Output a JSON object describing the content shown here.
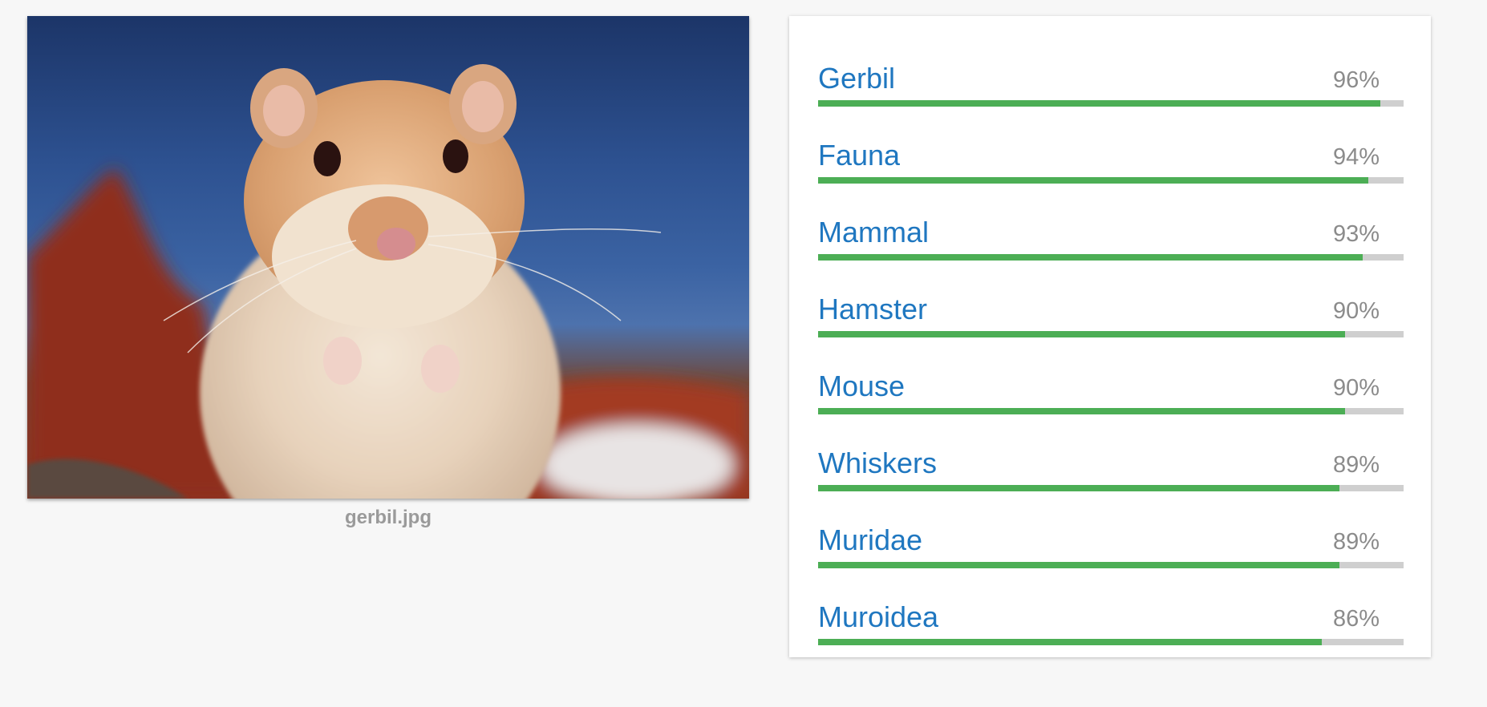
{
  "image": {
    "filename": "gerbil.jpg"
  },
  "colors": {
    "label": "#1f77c0",
    "bar_fill": "#4cae55",
    "bar_track": "#cfcfcf",
    "percent": "#8b8b8b"
  },
  "labels": [
    {
      "name": "Gerbil",
      "percent": "96%",
      "score": 0.96
    },
    {
      "name": "Fauna",
      "percent": "94%",
      "score": 0.94
    },
    {
      "name": "Mammal",
      "percent": "93%",
      "score": 0.93
    },
    {
      "name": "Hamster",
      "percent": "90%",
      "score": 0.9
    },
    {
      "name": "Mouse",
      "percent": "90%",
      "score": 0.9
    },
    {
      "name": "Whiskers",
      "percent": "89%",
      "score": 0.89
    },
    {
      "name": "Muridae",
      "percent": "89%",
      "score": 0.89
    },
    {
      "name": "Muroidea",
      "percent": "86%",
      "score": 0.86
    }
  ]
}
